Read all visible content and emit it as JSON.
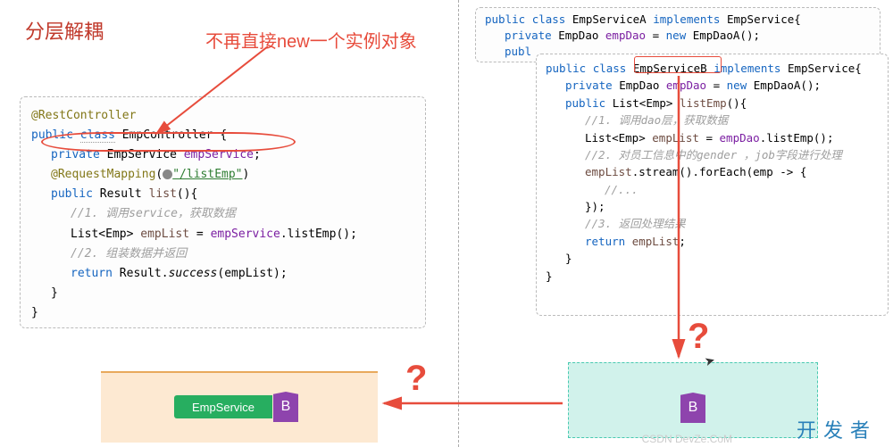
{
  "title": "分层解耦",
  "note": "不再直接new一个实例对象",
  "controller": {
    "anno1": "@RestController",
    "decl": {
      "kw1": "public",
      "kw2": "class",
      "name": "EmpController",
      "brace": "{"
    },
    "field": {
      "kw": "private",
      "type": "EmpService",
      "name": "empService",
      "semi": ";"
    },
    "anno2": {
      "name": "@RequestMapping",
      "arg": "\"/listEmp\""
    },
    "method": {
      "kw": "public",
      "ret": "Result",
      "name": "list",
      "sig": "(){"
    },
    "c1": "//1. 调用service，获取数据",
    "l1a": "List<Emp>",
    "l1b": "empList",
    "l1c": " = ",
    "l1d": "empService",
    "l1e": ".listEmp();",
    "c2": "//2. 组装数据并返回",
    "l2a": "return ",
    "l2b": "Result",
    "l2c": ".",
    "l2d": "success",
    "l2e": "(empList);",
    "closeM": "}",
    "closeC": "}"
  },
  "serviceA": {
    "kw1": "public",
    "kw2": "class",
    "name": "EmpServiceA",
    "kw3": "implements",
    "iface": "EmpService",
    "brace": "{",
    "f_kw": "private",
    "f_type": "EmpDao",
    "f_name": "empDao",
    "f_eq": " = ",
    "f_new": "new",
    "f_ctor": " EmpDaoA();",
    "m_kw": "publ"
  },
  "serviceB": {
    "kw1": "public",
    "kw2": "class",
    "name": "EmpServiceB",
    "kw3": "implements",
    "iface": "EmpService",
    "brace": "{",
    "f_kw": "private",
    "f_type": "EmpDao",
    "f_name": "empDao",
    "f_eq": " = ",
    "f_new": "new",
    "f_ctor": " EmpDaoA();",
    "m_kw": "public",
    "m_ret": "List<Emp>",
    "m_name": "listEmp",
    "m_sig": "(){",
    "c1": "//1. 调用dao层，获取数据",
    "l1a": "List<Emp> ",
    "l1b": "empList",
    "l1c": " = ",
    "l1d": "empDao",
    "l1e": ".listEmp();",
    "c2": "//2. 对员工信息中的gender ，job字段进行处理",
    "l2a": "empList",
    "l2b": ".stream().forEach(emp -> {",
    "c3": "//...",
    "l3": "});",
    "c4": "//3. 返回处理结果",
    "l4a": "return ",
    "l4b": "empList",
    "l4c": ";",
    "closeM": "}",
    "closeC": "}"
  },
  "chips": {
    "service": "EmpService",
    "b": "B"
  },
  "brand": "开发者",
  "watermark": "CSDN DevZe.CoM"
}
